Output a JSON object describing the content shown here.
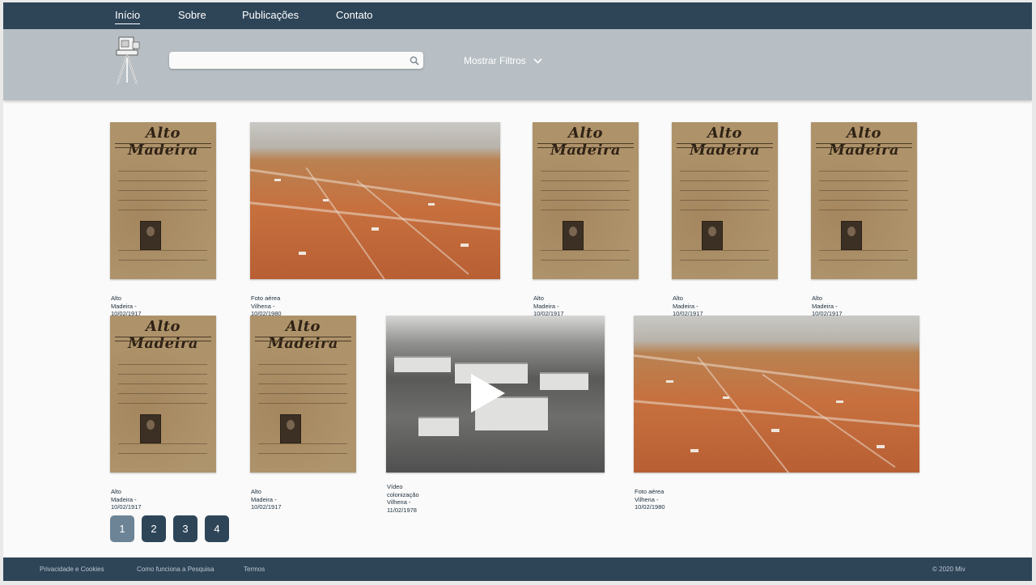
{
  "nav": {
    "items": [
      {
        "label": "Início",
        "active": true
      },
      {
        "label": "Sobre",
        "active": false
      },
      {
        "label": "Publicações",
        "active": false
      },
      {
        "label": "Contato",
        "active": false
      }
    ]
  },
  "search": {
    "value": "",
    "placeholder": ""
  },
  "filters": {
    "label": "Mostrar Filtros"
  },
  "cards": [
    {
      "type": "newspaper",
      "masthead": "Alto Madeira",
      "title": "Alto Madeira -",
      "date": "10/02/1917"
    },
    {
      "type": "aerial",
      "title": "Foto aérea Vilhena -",
      "date": "10/02/1980"
    },
    {
      "type": "newspaper",
      "masthead": "Alto Madeira",
      "title": "Alto Madeira -",
      "date": "10/02/1917"
    },
    {
      "type": "newspaper",
      "masthead": "Alto Madeira",
      "title": "Alto Madeira -",
      "date": "10/02/1917"
    },
    {
      "type": "newspaper",
      "masthead": "Alto Madeira",
      "title": "Alto Madeira -",
      "date": "10/02/1917"
    },
    {
      "type": "newspaper",
      "masthead": "Alto Madeira",
      "title": "Alto Madeira -",
      "date": "10/02/1917"
    },
    {
      "type": "newspaper",
      "masthead": "Alto Madeira",
      "title": "Alto Madeira -",
      "date": "10/02/1917"
    },
    {
      "type": "video",
      "title": "Vídeo colonização Vilhena -",
      "date": "11/02/1978"
    },
    {
      "type": "aerial",
      "title": "Foto aérea Vilhena -",
      "date": "10/02/1980"
    }
  ],
  "pagination": {
    "pages": [
      "1",
      "2",
      "3",
      "4"
    ],
    "current": "1"
  },
  "footer": {
    "links": [
      "Privacidade e Cookies",
      "Como funciona a Pesquisa",
      "Termos"
    ],
    "copyright": "© 2020 Miv"
  },
  "colors": {
    "nav_bg": "#2e4558",
    "band_bg": "#b7bfc4",
    "page_active": "#6c8496"
  }
}
